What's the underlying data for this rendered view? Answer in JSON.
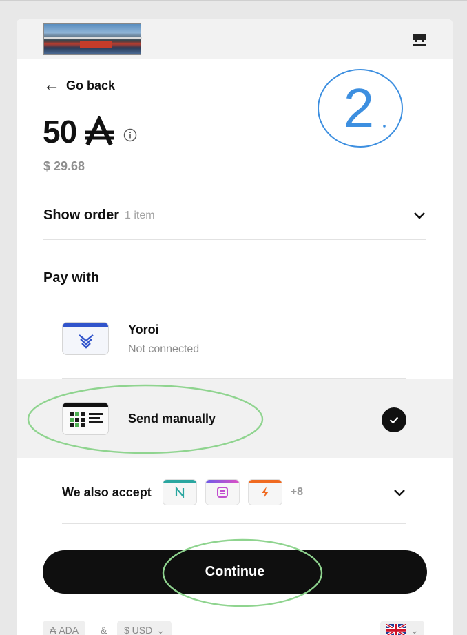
{
  "header": {
    "logo_icon": "merchant-logo-image",
    "store_icon": "store-icon"
  },
  "nav": {
    "back_label": "Go back",
    "back_icon": "arrow-left-icon"
  },
  "payment": {
    "amount": "50",
    "currency_icon": "ada-symbol-icon",
    "fiat": "$ 29.68"
  },
  "order": {
    "label": "Show order",
    "count": "1 item"
  },
  "pay_with": {
    "title": "Pay with",
    "methods": [
      {
        "name": "Yoroi",
        "status": "Not connected",
        "icon": "yoroi-wallet-icon"
      },
      {
        "name": "Send manually",
        "icon": "qr-code-icon",
        "selected": true
      }
    ]
  },
  "accept": {
    "label": "We also accept",
    "more": "+8",
    "icons": [
      "nami-wallet-icon",
      "eternl-wallet-icon",
      "flint-wallet-icon"
    ]
  },
  "continue_label": "Continue",
  "footer": {
    "token": "ADA",
    "amp": "&",
    "fiat": "$ USD"
  },
  "annotation": {
    "step_number": "2"
  },
  "colors": {
    "accent_blue": "#3d8fe0",
    "annotation_green": "#8fd48f",
    "button": "#0f0f0f"
  }
}
